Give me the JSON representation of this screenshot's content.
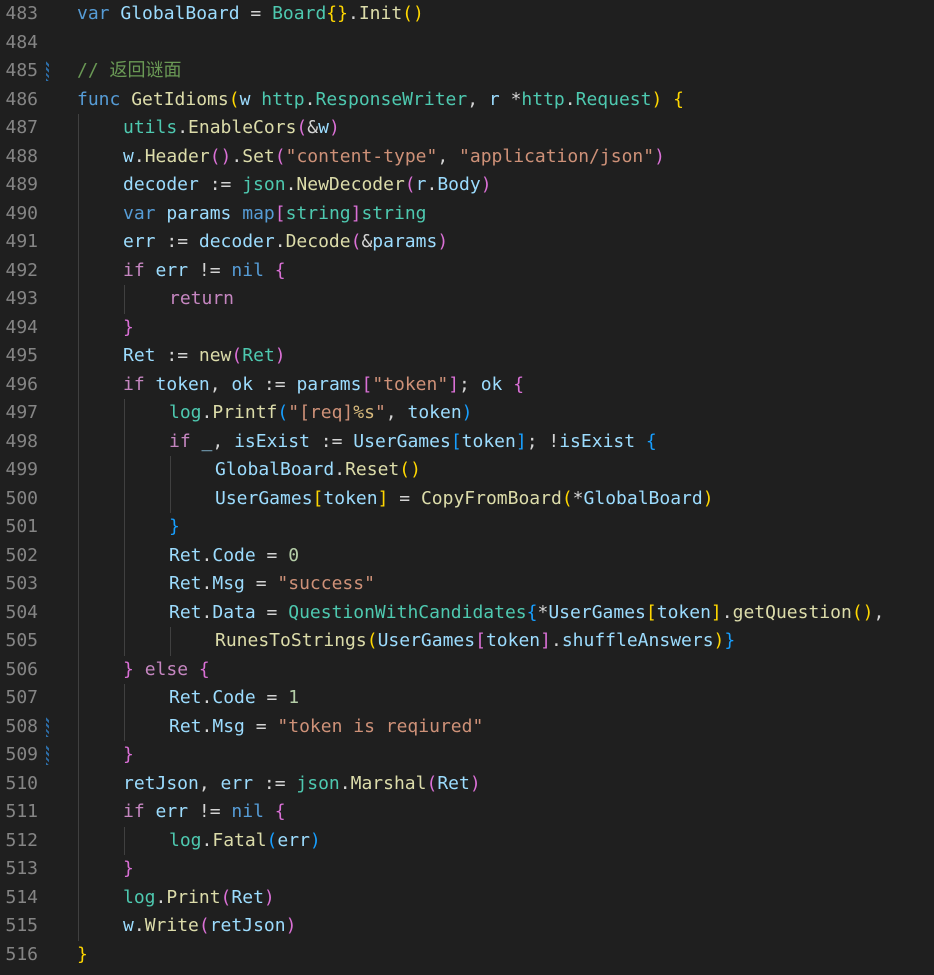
{
  "editor": {
    "language": "go",
    "colors": {
      "background": "#1f1f1f",
      "line_number": "#858585",
      "keyword": "#569cd6",
      "control": "#c586c0",
      "function": "#dcdcaa",
      "variable": "#9cdcfe",
      "type": "#4ec9b0",
      "string": "#ce9178",
      "number": "#b5cea8",
      "comment": "#6a9955",
      "bracket_1": "#ffd700",
      "bracket_2": "#da70d6",
      "bracket_3": "#179fff"
    },
    "lines": [
      {
        "num": "483",
        "indent": 0,
        "modified": false,
        "tokens": [
          [
            "kw",
            "var"
          ],
          [
            "pl",
            " "
          ],
          [
            "var",
            "GlobalBoard"
          ],
          [
            "pl",
            " = "
          ],
          [
            "type",
            "Board"
          ],
          [
            "b1",
            "{}"
          ],
          [
            "pl",
            "."
          ],
          [
            "fn",
            "Init"
          ],
          [
            "b1",
            "()"
          ]
        ]
      },
      {
        "num": "484",
        "indent": 0,
        "modified": false,
        "tokens": []
      },
      {
        "num": "485",
        "indent": 0,
        "modified": true,
        "tokens": [
          [
            "com",
            "// 返回谜面"
          ]
        ]
      },
      {
        "num": "486",
        "indent": 0,
        "modified": false,
        "tokens": [
          [
            "kw",
            "func"
          ],
          [
            "pl",
            " "
          ],
          [
            "fn",
            "GetIdioms"
          ],
          [
            "b1",
            "("
          ],
          [
            "var",
            "w"
          ],
          [
            "pl",
            " "
          ],
          [
            "type",
            "http"
          ],
          [
            "pl",
            "."
          ],
          [
            "type",
            "ResponseWriter"
          ],
          [
            "pl",
            ", "
          ],
          [
            "var",
            "r"
          ],
          [
            "pl",
            " *"
          ],
          [
            "type",
            "http"
          ],
          [
            "pl",
            "."
          ],
          [
            "type",
            "Request"
          ],
          [
            "b1",
            ")"
          ],
          [
            "pl",
            " "
          ],
          [
            "b1",
            "{"
          ]
        ]
      },
      {
        "num": "487",
        "indent": 1,
        "modified": false,
        "tokens": [
          [
            "type",
            "utils"
          ],
          [
            "pl",
            "."
          ],
          [
            "fn",
            "EnableCors"
          ],
          [
            "b2",
            "("
          ],
          [
            "pl",
            "&"
          ],
          [
            "var",
            "w"
          ],
          [
            "b2",
            ")"
          ]
        ]
      },
      {
        "num": "488",
        "indent": 1,
        "modified": false,
        "tokens": [
          [
            "var",
            "w"
          ],
          [
            "pl",
            "."
          ],
          [
            "fn",
            "Header"
          ],
          [
            "b2",
            "()"
          ],
          [
            "pl",
            "."
          ],
          [
            "fn",
            "Set"
          ],
          [
            "b2",
            "("
          ],
          [
            "str",
            "\"content-type\""
          ],
          [
            "pl",
            ", "
          ],
          [
            "str",
            "\"application/json\""
          ],
          [
            "b2",
            ")"
          ]
        ]
      },
      {
        "num": "489",
        "indent": 1,
        "modified": false,
        "tokens": [
          [
            "var",
            "decoder"
          ],
          [
            "pl",
            " := "
          ],
          [
            "type",
            "json"
          ],
          [
            "pl",
            "."
          ],
          [
            "fn",
            "NewDecoder"
          ],
          [
            "b2",
            "("
          ],
          [
            "var",
            "r"
          ],
          [
            "pl",
            "."
          ],
          [
            "var",
            "Body"
          ],
          [
            "b2",
            ")"
          ]
        ]
      },
      {
        "num": "490",
        "indent": 1,
        "modified": false,
        "tokens": [
          [
            "kw",
            "var"
          ],
          [
            "pl",
            " "
          ],
          [
            "var",
            "params"
          ],
          [
            "pl",
            " "
          ],
          [
            "kw",
            "map"
          ],
          [
            "b2",
            "["
          ],
          [
            "type",
            "string"
          ],
          [
            "b2",
            "]"
          ],
          [
            "type",
            "string"
          ]
        ]
      },
      {
        "num": "491",
        "indent": 1,
        "modified": false,
        "tokens": [
          [
            "var",
            "err"
          ],
          [
            "pl",
            " := "
          ],
          [
            "var",
            "decoder"
          ],
          [
            "pl",
            "."
          ],
          [
            "fn",
            "Decode"
          ],
          [
            "b2",
            "("
          ],
          [
            "pl",
            "&"
          ],
          [
            "var",
            "params"
          ],
          [
            "b2",
            ")"
          ]
        ]
      },
      {
        "num": "492",
        "indent": 1,
        "modified": false,
        "tokens": [
          [
            "ctl",
            "if"
          ],
          [
            "pl",
            " "
          ],
          [
            "var",
            "err"
          ],
          [
            "pl",
            " != "
          ],
          [
            "kw",
            "nil"
          ],
          [
            "pl",
            " "
          ],
          [
            "b2",
            "{"
          ]
        ]
      },
      {
        "num": "493",
        "indent": 2,
        "modified": false,
        "tokens": [
          [
            "ctl",
            "return"
          ]
        ]
      },
      {
        "num": "494",
        "indent": 1,
        "modified": false,
        "tokens": [
          [
            "b2",
            "}"
          ]
        ]
      },
      {
        "num": "495",
        "indent": 1,
        "modified": false,
        "tokens": [
          [
            "var",
            "Ret"
          ],
          [
            "pl",
            " := "
          ],
          [
            "fn",
            "new"
          ],
          [
            "b2",
            "("
          ],
          [
            "type",
            "Ret"
          ],
          [
            "b2",
            ")"
          ]
        ]
      },
      {
        "num": "496",
        "indent": 1,
        "modified": false,
        "tokens": [
          [
            "ctl",
            "if"
          ],
          [
            "pl",
            " "
          ],
          [
            "var",
            "token"
          ],
          [
            "pl",
            ", "
          ],
          [
            "var",
            "ok"
          ],
          [
            "pl",
            " := "
          ],
          [
            "var",
            "params"
          ],
          [
            "b2",
            "["
          ],
          [
            "str",
            "\"token\""
          ],
          [
            "b2",
            "]"
          ],
          [
            "pl",
            "; "
          ],
          [
            "var",
            "ok"
          ],
          [
            "pl",
            " "
          ],
          [
            "b2",
            "{"
          ]
        ]
      },
      {
        "num": "497",
        "indent": 2,
        "modified": false,
        "tokens": [
          [
            "type",
            "log"
          ],
          [
            "pl",
            "."
          ],
          [
            "fn",
            "Printf"
          ],
          [
            "b3",
            "("
          ],
          [
            "str",
            "\"[req]"
          ],
          [
            "esc",
            "%s"
          ],
          [
            "str",
            "\""
          ],
          [
            "pl",
            ", "
          ],
          [
            "var",
            "token"
          ],
          [
            "b3",
            ")"
          ]
        ]
      },
      {
        "num": "498",
        "indent": 2,
        "modified": false,
        "tokens": [
          [
            "ctl",
            "if"
          ],
          [
            "pl",
            " "
          ],
          [
            "var",
            "_"
          ],
          [
            "pl",
            ", "
          ],
          [
            "var",
            "isExist"
          ],
          [
            "pl",
            " := "
          ],
          [
            "var",
            "UserGames"
          ],
          [
            "b3",
            "["
          ],
          [
            "var",
            "token"
          ],
          [
            "b3",
            "]"
          ],
          [
            "pl",
            "; !"
          ],
          [
            "var",
            "isExist"
          ],
          [
            "pl",
            " "
          ],
          [
            "b3",
            "{"
          ]
        ]
      },
      {
        "num": "499",
        "indent": 3,
        "modified": false,
        "tokens": [
          [
            "var",
            "GlobalBoard"
          ],
          [
            "pl",
            "."
          ],
          [
            "fn",
            "Reset"
          ],
          [
            "b1",
            "()"
          ]
        ]
      },
      {
        "num": "500",
        "indent": 3,
        "modified": false,
        "tokens": [
          [
            "var",
            "UserGames"
          ],
          [
            "b1",
            "["
          ],
          [
            "var",
            "token"
          ],
          [
            "b1",
            "]"
          ],
          [
            "pl",
            " = "
          ],
          [
            "fn",
            "CopyFromBoard"
          ],
          [
            "b1",
            "("
          ],
          [
            "pl",
            "*"
          ],
          [
            "var",
            "GlobalBoard"
          ],
          [
            "b1",
            ")"
          ]
        ]
      },
      {
        "num": "501",
        "indent": 2,
        "modified": false,
        "tokens": [
          [
            "b3",
            "}"
          ]
        ]
      },
      {
        "num": "502",
        "indent": 2,
        "modified": false,
        "tokens": [
          [
            "var",
            "Ret"
          ],
          [
            "pl",
            "."
          ],
          [
            "var",
            "Code"
          ],
          [
            "pl",
            " = "
          ],
          [
            "num",
            "0"
          ]
        ]
      },
      {
        "num": "503",
        "indent": 2,
        "modified": false,
        "tokens": [
          [
            "var",
            "Ret"
          ],
          [
            "pl",
            "."
          ],
          [
            "var",
            "Msg"
          ],
          [
            "pl",
            " = "
          ],
          [
            "str",
            "\"success\""
          ]
        ]
      },
      {
        "num": "504",
        "indent": 2,
        "modified": false,
        "tokens": [
          [
            "var",
            "Ret"
          ],
          [
            "pl",
            "."
          ],
          [
            "var",
            "Data"
          ],
          [
            "pl",
            " = "
          ],
          [
            "type",
            "QuestionWithCandidates"
          ],
          [
            "b3",
            "{"
          ],
          [
            "pl",
            "*"
          ],
          [
            "var",
            "UserGames"
          ],
          [
            "b1",
            "["
          ],
          [
            "var",
            "token"
          ],
          [
            "b1",
            "]"
          ],
          [
            "pl",
            "."
          ],
          [
            "fn",
            "getQuestion"
          ],
          [
            "b1",
            "()"
          ],
          [
            "pl",
            ","
          ]
        ]
      },
      {
        "num": "505",
        "indent": 3,
        "modified": false,
        "tokens": [
          [
            "fn",
            "RunesToStrings"
          ],
          [
            "b1",
            "("
          ],
          [
            "var",
            "UserGames"
          ],
          [
            "b2",
            "["
          ],
          [
            "var",
            "token"
          ],
          [
            "b2",
            "]"
          ],
          [
            "pl",
            "."
          ],
          [
            "var",
            "shuffleAnswers"
          ],
          [
            "b1",
            ")"
          ],
          [
            "b3",
            "}"
          ]
        ]
      },
      {
        "num": "506",
        "indent": 1,
        "modified": false,
        "tokens": [
          [
            "b2",
            "}"
          ],
          [
            "pl",
            " "
          ],
          [
            "ctl",
            "else"
          ],
          [
            "pl",
            " "
          ],
          [
            "b2",
            "{"
          ]
        ]
      },
      {
        "num": "507",
        "indent": 2,
        "modified": false,
        "tokens": [
          [
            "var",
            "Ret"
          ],
          [
            "pl",
            "."
          ],
          [
            "var",
            "Code"
          ],
          [
            "pl",
            " = "
          ],
          [
            "num",
            "1"
          ]
        ]
      },
      {
        "num": "508",
        "indent": 2,
        "modified": true,
        "tokens": [
          [
            "var",
            "Ret"
          ],
          [
            "pl",
            "."
          ],
          [
            "var",
            "Msg"
          ],
          [
            "pl",
            " = "
          ],
          [
            "str",
            "\"token is reqiured\""
          ]
        ]
      },
      {
        "num": "509",
        "indent": 1,
        "modified": true,
        "tokens": [
          [
            "b2",
            "}"
          ]
        ]
      },
      {
        "num": "510",
        "indent": 1,
        "modified": false,
        "tokens": [
          [
            "var",
            "retJson"
          ],
          [
            "pl",
            ", "
          ],
          [
            "var",
            "err"
          ],
          [
            "pl",
            " := "
          ],
          [
            "type",
            "json"
          ],
          [
            "pl",
            "."
          ],
          [
            "fn",
            "Marshal"
          ],
          [
            "b2",
            "("
          ],
          [
            "var",
            "Ret"
          ],
          [
            "b2",
            ")"
          ]
        ]
      },
      {
        "num": "511",
        "indent": 1,
        "modified": false,
        "tokens": [
          [
            "ctl",
            "if"
          ],
          [
            "pl",
            " "
          ],
          [
            "var",
            "err"
          ],
          [
            "pl",
            " != "
          ],
          [
            "kw",
            "nil"
          ],
          [
            "pl",
            " "
          ],
          [
            "b2",
            "{"
          ]
        ]
      },
      {
        "num": "512",
        "indent": 2,
        "modified": false,
        "tokens": [
          [
            "type",
            "log"
          ],
          [
            "pl",
            "."
          ],
          [
            "fn",
            "Fatal"
          ],
          [
            "b3",
            "("
          ],
          [
            "var",
            "err"
          ],
          [
            "b3",
            ")"
          ]
        ]
      },
      {
        "num": "513",
        "indent": 1,
        "modified": false,
        "tokens": [
          [
            "b2",
            "}"
          ]
        ]
      },
      {
        "num": "514",
        "indent": 1,
        "modified": false,
        "tokens": [
          [
            "type",
            "log"
          ],
          [
            "pl",
            "."
          ],
          [
            "fn",
            "Print"
          ],
          [
            "b2",
            "("
          ],
          [
            "var",
            "Ret"
          ],
          [
            "b2",
            ")"
          ]
        ]
      },
      {
        "num": "515",
        "indent": 1,
        "modified": false,
        "tokens": [
          [
            "var",
            "w"
          ],
          [
            "pl",
            "."
          ],
          [
            "fn",
            "Write"
          ],
          [
            "b2",
            "("
          ],
          [
            "var",
            "retJson"
          ],
          [
            "b2",
            ")"
          ]
        ]
      },
      {
        "num": "516",
        "indent": 0,
        "modified": false,
        "tokens": [
          [
            "b1",
            "}"
          ]
        ]
      }
    ]
  }
}
